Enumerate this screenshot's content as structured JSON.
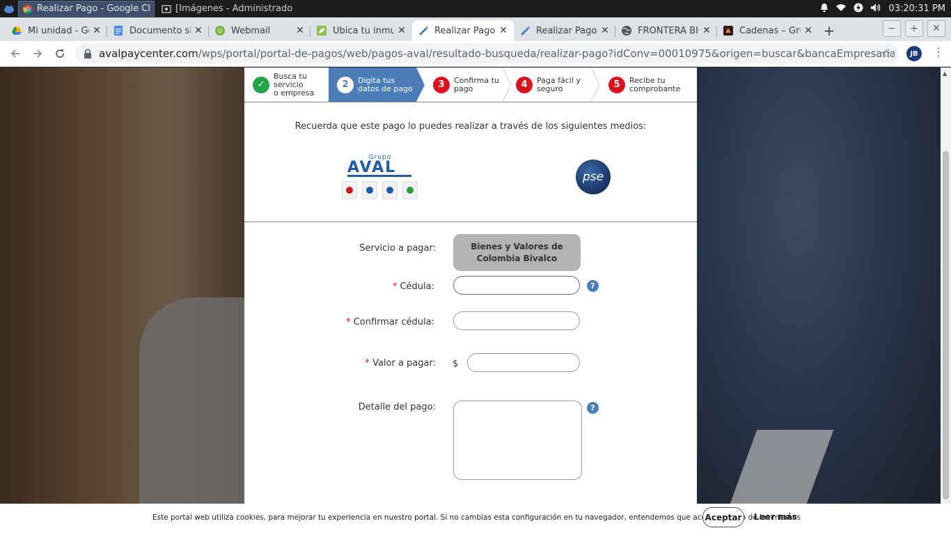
{
  "taskbar": {
    "tasks": [
      {
        "label": "Realizar Pago - Google Chro..."
      },
      {
        "label": "[Imágenes - Administrador d..."
      }
    ],
    "clock": "03:20:31 PM"
  },
  "browser": {
    "tabs": [
      {
        "label": "Mi unidad - Go"
      },
      {
        "label": "Documento sin"
      },
      {
        "label": "Webmail"
      },
      {
        "label": "Ubica tu inmue"
      },
      {
        "label": "Realizar Pago"
      },
      {
        "label": "Realizar Pago"
      },
      {
        "label": "FRONTERA BIO"
      },
      {
        "label": "Cadenas – Gru"
      }
    ],
    "url_host": "avalpaycenter.com",
    "url_path": "/wps/portal/portal-de-pagos/web/pagos-aval/resultado-busqueda/realizar-pago?idConv=00010975&origen=buscar&bancaEmpresarial=false&lo...",
    "profile_initials": "JB"
  },
  "steps": [
    {
      "number": "✓",
      "label_line1": "Busca tu servicio",
      "label_line2": "o empresa"
    },
    {
      "number": "2",
      "label_line1": "Digita tus",
      "label_line2": "datos de pago"
    },
    {
      "number": "3",
      "label_line1": "Confirma tu",
      "label_line2": "pago"
    },
    {
      "number": "4",
      "label_line1": "Paga fácil y",
      "label_line2": "seguro"
    },
    {
      "number": "5",
      "label_line1": "Recibe tu",
      "label_line2": "comprobante"
    }
  ],
  "notice": "Recuerda que este pago lo puedes realizar a través de los siguientes medios:",
  "logos": {
    "aval_top": "Grupo",
    "aval_main": "AVAL",
    "pse": "pse"
  },
  "form": {
    "service_label": "Servicio a pagar:",
    "service_value": "Bienes y Valores de Colombia Bivalco",
    "required_mark": "*",
    "cedula_label": "Cédula:",
    "cedula_value": "",
    "confirm_label": "Confirmar cédula:",
    "confirm_value": "",
    "amount_label": "Valor a pagar:",
    "currency": "$",
    "amount_value": "",
    "detail_label": "Detalle del pago:",
    "detail_value": "",
    "help_glyph": "?"
  },
  "cookie": {
    "message": "Este portal web utiliza cookies, para mejorar tu experiencia en nuestro portal. Si no cambias esta configuración en tu navegador, entendemos que aceptas el uso de las mismas",
    "accept_label": "Aceptar",
    "more_label": "Leer más"
  },
  "colors": {
    "step_active": "#4b7eb8",
    "step_done": "#23a447",
    "step_pending": "#d7141f",
    "help_icon": "#4b7eb8"
  }
}
